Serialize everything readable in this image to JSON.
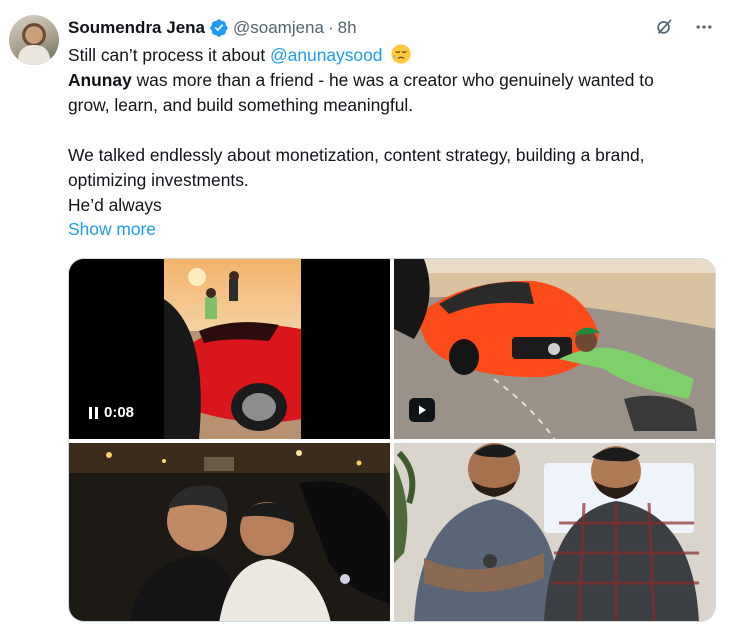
{
  "author": {
    "name": "Soumendra Jena",
    "handle": "@soamjena",
    "separator": "·",
    "time": "8h",
    "verified": true,
    "verified_color": "#1d9bf0"
  },
  "header_icons": [
    "grok-icon",
    "more-icon"
  ],
  "body": {
    "line1_text": "Still can’t process it about ",
    "line1_mention": "@anunaysood",
    "line1_emoji": "sad-relieved-emoji",
    "line2_bold": "Anunay",
    "line2_rest": " was more than a friend - he was a creator who genuinely wanted to",
    "line3": "grow, learn, and build something meaningful.",
    "line4": "We talked endlessly about monetization, content strategy, building a brand,",
    "line5": "optimizing investments.",
    "line6": "He’d always"
  },
  "show_more": "Show more",
  "media": {
    "video1_time": "0:08",
    "video1_state": "playing",
    "video2_state": "paused"
  },
  "colors": {
    "link": "#1d9bf0",
    "text": "#0f1419",
    "muted": "#536471",
    "border": "#cfd9de"
  }
}
